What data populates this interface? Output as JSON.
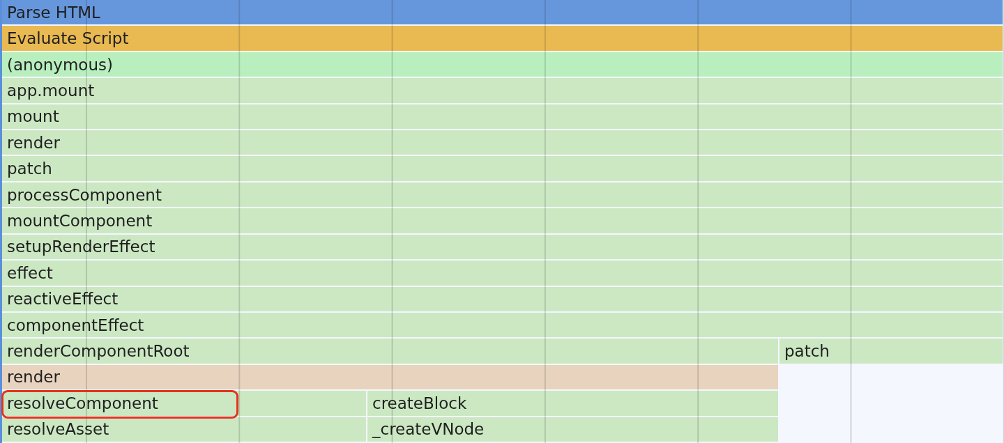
{
  "flame_chart": {
    "entries": [
      {
        "name": "Parse HTML",
        "color": "#6697dc",
        "highlighted": false,
        "children": [
          {
            "name": "Evaluate Script",
            "color": "#e9b952",
            "highlighted": false,
            "children": [
              {
                "name": "(anonymous)",
                "color": "#b9efbe",
                "highlighted": false,
                "children": [
                  {
                    "name": "app.mount",
                    "color": "#cbe8c3",
                    "highlighted": false,
                    "children": [
                      {
                        "name": "mount",
                        "color": "#cbe8c3",
                        "highlighted": false,
                        "children": [
                          {
                            "name": "render",
                            "color": "#cbe8c3",
                            "highlighted": false,
                            "children": [
                              {
                                "name": "patch",
                                "color": "#cbe8c3",
                                "highlighted": false,
                                "children": [
                                  {
                                    "name": "processComponent",
                                    "color": "#cbe8c3",
                                    "highlighted": false,
                                    "children": [
                                      {
                                        "name": "mountComponent",
                                        "color": "#cbe8c3",
                                        "highlighted": false,
                                        "children": [
                                          {
                                            "name": "setupRenderEffect",
                                            "color": "#cbe8c3",
                                            "highlighted": false,
                                            "children": [
                                              {
                                                "name": "effect",
                                                "color": "#cbe8c3",
                                                "highlighted": false,
                                                "children": [
                                                  {
                                                    "name": "reactiveEffect",
                                                    "color": "#cbe8c3",
                                                    "highlighted": false,
                                                    "children": [
                                                      {
                                                        "name": "componentEffect",
                                                        "color": "#cbe8c3",
                                                        "highlighted": false,
                                                        "children": [
                                                          {
                                                            "name": "renderComponentRoot",
                                                            "color": "#cbe8c3",
                                                            "highlighted": false,
                                                            "children": [
                                                              {
                                                                "name": "render",
                                                                "color": "#e8d3bf",
                                                                "highlighted": false,
                                                                "children": [
                                                                  {
                                                                    "name": "resolveComponent",
                                                                    "color": "#cbe8c3",
                                                                    "highlighted": true,
                                                                    "children": [
                                                                      {
                                                                        "name": "resolveAsset",
                                                                        "color": "#cbe8c3",
                                                                        "highlighted": false
                                                                      }
                                                                    ]
                                                                  },
                                                                  {
                                                                    "name": "createBlock",
                                                                    "color": "#cbe8c3",
                                                                    "highlighted": false,
                                                                    "children": [
                                                                      {
                                                                        "name": "_createVNode",
                                                                        "color": "#cbe8c3",
                                                                        "highlighted": false
                                                                      }
                                                                    ]
                                                                  }
                                                                ]
                                                              }
                                                            ]
                                                          },
                                                          {
                                                            "name": "patch",
                                                            "color": "#cbe8c3",
                                                            "highlighted": false
                                                          }
                                                        ]
                                                      }
                                                    ]
                                                  }
                                                ]
                                              }
                                            ]
                                          }
                                        ]
                                      }
                                    ]
                                  }
                                ]
                              }
                            ]
                          }
                        ]
                      }
                    ]
                  }
                ]
              }
            ]
          }
        ]
      }
    ]
  }
}
